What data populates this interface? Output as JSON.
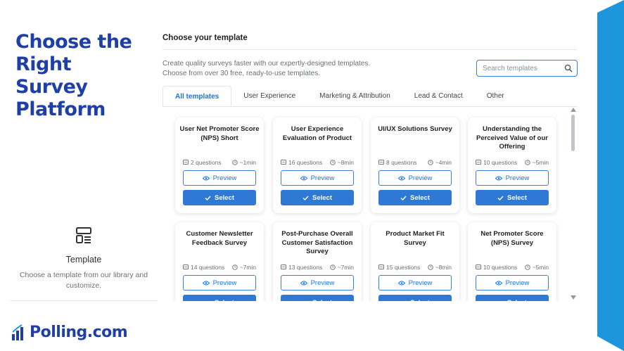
{
  "slide": {
    "headline": "Choose the Right Survey Platform",
    "brand": "Polling.com",
    "accent_color": "#1f3fa8",
    "band_color": "#1e96dc"
  },
  "sidebar_card": {
    "icon": "template-layout-icon",
    "title": "Template",
    "description": "Choose a template from our library and customize."
  },
  "panel": {
    "title": "Choose your template",
    "description_line1": "Create quality surveys faster with our expertly-designed templates.",
    "description_line2": "Choose from over 30 free, ready-to-use templates.",
    "search_placeholder": "Search templates",
    "tabs": [
      {
        "label": "All templates",
        "active": true
      },
      {
        "label": "User Experience",
        "active": false
      },
      {
        "label": "Marketing & Attribution",
        "active": false
      },
      {
        "label": "Lead & Contact",
        "active": false
      },
      {
        "label": "Other",
        "active": false
      }
    ],
    "preview_label": "Preview",
    "select_label": "Select",
    "button_color": "#2f78d4",
    "templates": [
      {
        "title": "User Net Promoter Score (NPS) Short",
        "questions": "2 questions",
        "time": "~1min"
      },
      {
        "title": "User Experience Evaluation of Product",
        "questions": "16 questions",
        "time": "~8min"
      },
      {
        "title": "UI/UX Solutions Survey",
        "questions": "8 questions",
        "time": "~4min"
      },
      {
        "title": "Understanding the Perceived Value of our Offering",
        "questions": "10 questions",
        "time": "~5min"
      },
      {
        "title": "Customer Newsletter Feedback Survey",
        "questions": "14 questions",
        "time": "~7min"
      },
      {
        "title": "Post-Purchase Overall Customer Satisfaction Survey",
        "questions": "13 questions",
        "time": "~7min"
      },
      {
        "title": "Product Market Fit Survey",
        "questions": "15 questions",
        "time": "~8min"
      },
      {
        "title": "Net Promoter Score (NPS) Survey",
        "questions": "10 questions",
        "time": "~5min"
      }
    ]
  }
}
